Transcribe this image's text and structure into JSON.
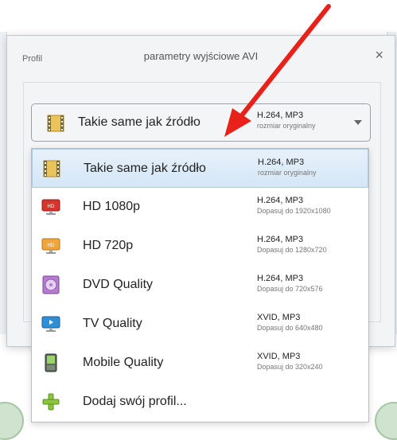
{
  "dialog": {
    "title": "parametry wyjściowe AVI",
    "close_label": "×",
    "group_label": "Profil"
  },
  "combo": {
    "label": "Takie same jak źródło",
    "codec": "H.264, MP3",
    "detail": "rozmiar oryginalny",
    "icon": "film-icon"
  },
  "items": [
    {
      "label": "Takie same jak źródło",
      "codec": "H.264, MP3",
      "detail": "rozmiar oryginalny",
      "icon": "film-icon"
    },
    {
      "label": "HD 1080p",
      "codec": "H.264, MP3",
      "detail": "Dopasuj do 1920x1080",
      "icon": "hd-monitor-red-icon"
    },
    {
      "label": "HD 720p",
      "codec": "H.264, MP3",
      "detail": "Dopasuj do 1280x720",
      "icon": "hd-monitor-orange-icon"
    },
    {
      "label": "DVD Quality",
      "codec": "H.264, MP3",
      "detail": "Dopasuj do 720x576",
      "icon": "dvd-icon"
    },
    {
      "label": "TV Quality",
      "codec": "XVID, MP3",
      "detail": "Dopasuj do 640x480",
      "icon": "tv-icon"
    },
    {
      "label": "Mobile Quality",
      "codec": "XVID, MP3",
      "detail": "Dopasuj do 320x240",
      "icon": "mobile-icon"
    },
    {
      "label": "Dodaj swój profil...",
      "icon": "plus-icon"
    }
  ],
  "colors": {
    "annotation_arrow": "#e8221b",
    "selection_bg": "#d5e6f6"
  }
}
